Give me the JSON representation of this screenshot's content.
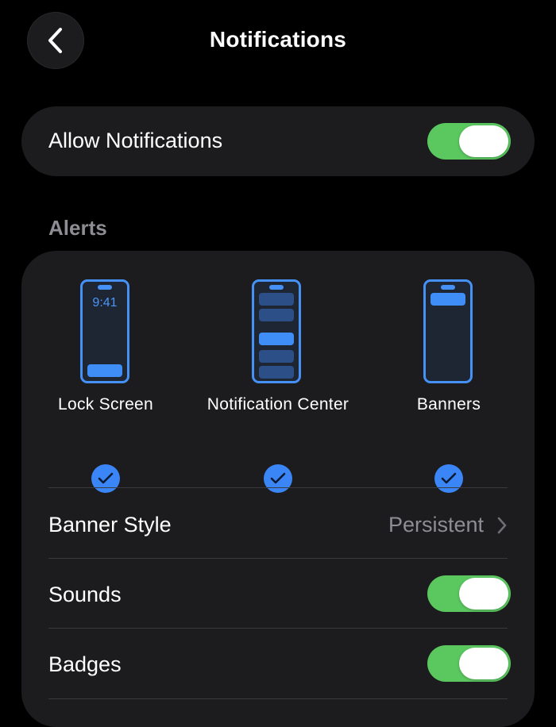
{
  "header": {
    "title": "Notifications",
    "back_icon": "chevron-left-icon"
  },
  "allow_notifications": {
    "label": "Allow Notifications",
    "enabled": true
  },
  "alerts": {
    "header": "Alerts",
    "options": [
      {
        "label": "Lock Screen",
        "clock": "9:41",
        "selected": true
      },
      {
        "label": "Notification Center",
        "selected": true
      },
      {
        "label": "Banners",
        "selected": true
      }
    ],
    "rows": [
      {
        "label": "Banner Style",
        "value": "Persistent",
        "icon": "chevron-right-icon"
      },
      {
        "label": "Sounds",
        "enabled": true
      },
      {
        "label": "Badges",
        "enabled": true
      }
    ]
  },
  "colors": {
    "background": "#000000",
    "card": "#1c1c1e",
    "toggle_on": "#5ac85f",
    "accent_blue": "#3b86f6",
    "secondary_text": "#8d8d93"
  }
}
